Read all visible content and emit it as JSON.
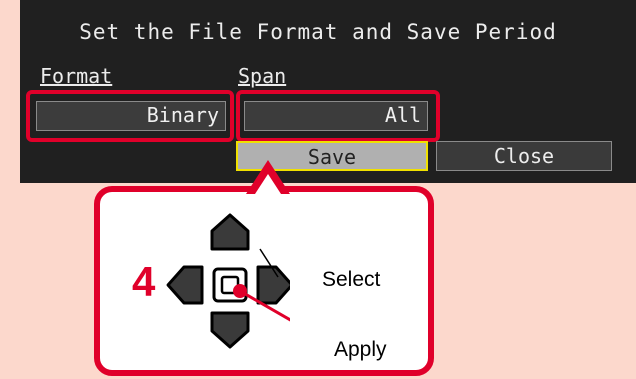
{
  "dialog": {
    "title": "Set the File Format and Save Period",
    "format_label": "Format",
    "format_value": "Binary",
    "span_label": "Span",
    "span_value": "All",
    "save_label": "Save",
    "close_label": "Close"
  },
  "callout": {
    "step_number": "4",
    "select_label": "Select",
    "apply_label": "Apply"
  },
  "colors": {
    "highlight": "#e0002a",
    "focus": "#f0e000",
    "panel": "#202020",
    "background": "#fcd8cc"
  }
}
